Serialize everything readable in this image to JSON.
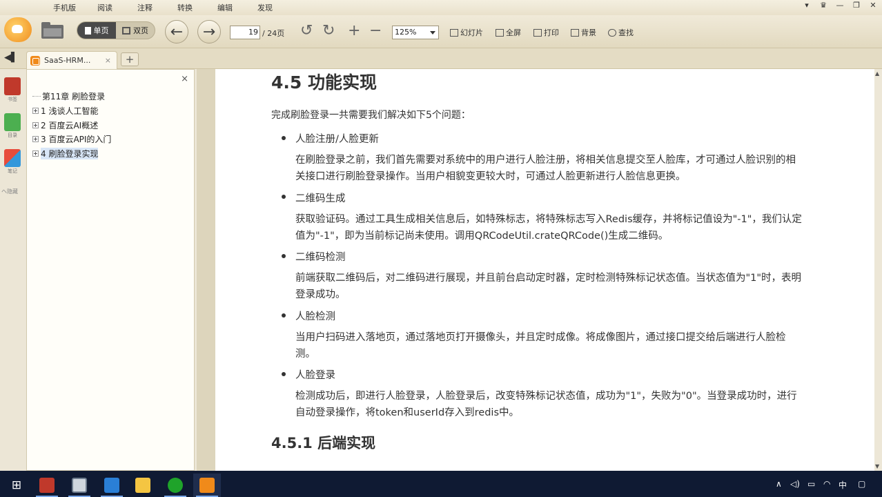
{
  "menu": [
    "手机版",
    "阅读",
    "注释",
    "转换",
    "编辑",
    "发现"
  ],
  "toolbar": {
    "view_single": "单页",
    "view_double": "双页",
    "page_current": "19",
    "page_total": "/ 24页",
    "zoom": "125%",
    "slideshow": "幻灯片",
    "fullscreen": "全屏",
    "print": "打印",
    "background": "背景",
    "find": "查找"
  },
  "tab": {
    "label": "SaaS-HRM...",
    "close": "×",
    "add": "+"
  },
  "side_strip": {
    "bookmark": "书签",
    "outline": "目录",
    "notes": "笔记",
    "hint": "ヘ隐藏"
  },
  "outline": {
    "close": "×",
    "items": [
      {
        "label": "第11章 刷脸登录",
        "expandable": false
      },
      {
        "label": "1 浅谈人工智能",
        "expandable": true
      },
      {
        "label": "2 百度云AI概述",
        "expandable": true
      },
      {
        "label": "3 百度云API的入门",
        "expandable": true
      },
      {
        "label": "4 刷脸登录实现",
        "expandable": true,
        "selected": true
      }
    ]
  },
  "document": {
    "heading": "4.5 功能实现",
    "intro": "完成刷脸登录一共需要我们解决如下5个问题：",
    "sections": [
      {
        "title": "人脸注册/人脸更新",
        "body": "在刷脸登录之前，我们首先需要对系统中的用户进行人脸注册，将相关信息提交至人脸库，才可通过人脸识别的相关接口进行刷脸登录操作。当用户相貌变更较大时，可通过人脸更新进行人脸信息更换。"
      },
      {
        "title": "二维码生成",
        "body": "获取验证码。通过工具生成相关信息后，如特殊标志，将特殊标志写入Redis缓存，并将标记值设为\"-1\"，我们认定值为\"-1\"，即为当前标记尚未使用。调用QRCodeUtil.crateQRCode()生成二维码。"
      },
      {
        "title": "二维码检测",
        "body": "前端获取二维码后，对二维码进行展现，并且前台启动定时器，定时检测特殊标记状态值。当状态值为\"1\"时，表明登录成功。"
      },
      {
        "title": "人脸检测",
        "body": "当用户扫码进入落地页，通过落地页打开摄像头，并且定时成像。将成像图片，通过接口提交给后端进行人脸检测。"
      },
      {
        "title": "人脸登录",
        "body": "检测成功后，即进行人脸登录，人脸登录后，改变特殊标记状态值，成功为\"1\"，失败为\"0\"。当登录成功时，进行自动登录操作，将token和userId存入到redis中。"
      }
    ],
    "subheading": "4.5.1 后端实现"
  },
  "taskbar": {
    "apps": [
      "start-icon",
      "idea-icon",
      "window-icon",
      "vscode-icon",
      "explorer-icon",
      "terminal-icon",
      "reader-icon"
    ],
    "ime": "中"
  },
  "colors": {
    "accent": "#f08a1a",
    "taskbar": "#0f1a33",
    "page": "#ffffff",
    "chrome": "#ece6d6"
  }
}
